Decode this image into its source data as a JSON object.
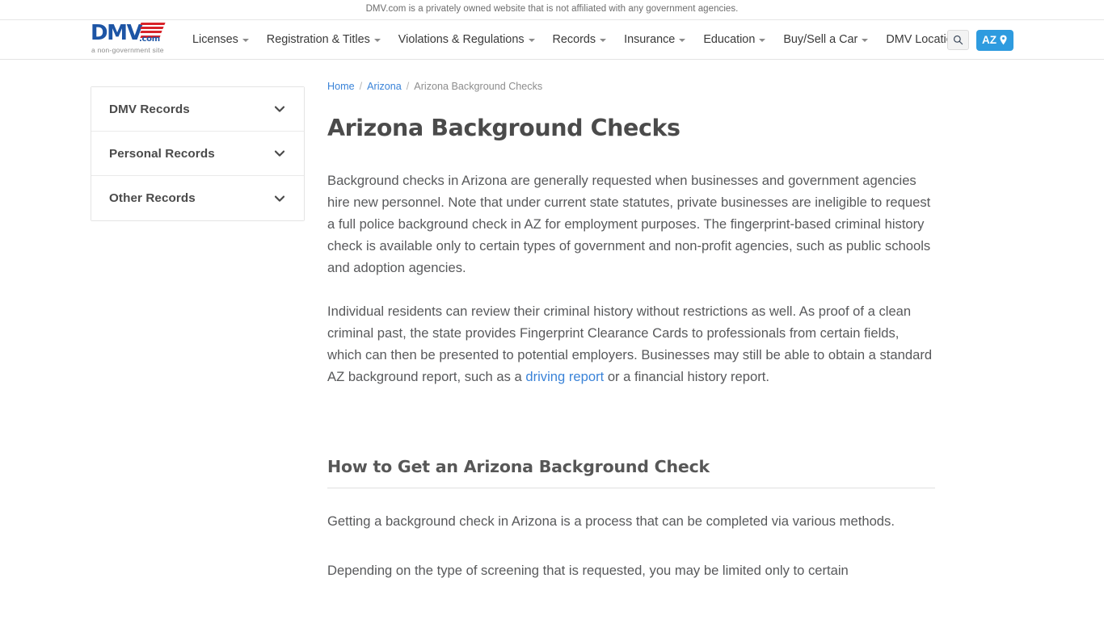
{
  "disclaimer": {
    "text": "DMV.com is a privately owned website that is not affiliated with any government agencies."
  },
  "header": {
    "logo": {
      "wordmark": "DMV",
      "dotcom": ".com",
      "tagline": "a non-government site",
      "brand_blue": "#1d55a5",
      "brand_red": "#d8232a"
    },
    "nav": [
      {
        "label": "Licenses",
        "has_dropdown": true
      },
      {
        "label": "Registration & Titles",
        "has_dropdown": true
      },
      {
        "label": "Violations & Regulations",
        "has_dropdown": true
      },
      {
        "label": "Records",
        "has_dropdown": true
      },
      {
        "label": "Insurance",
        "has_dropdown": true
      },
      {
        "label": "Education",
        "has_dropdown": true
      },
      {
        "label": "Buy/Sell a Car",
        "has_dropdown": true
      },
      {
        "label": "DMV Locations",
        "has_dropdown": false
      }
    ],
    "search_icon": "search-icon",
    "state_button": {
      "label": "AZ",
      "icon": "map-pin-icon",
      "color": "#2e9bdf"
    }
  },
  "sidebar": {
    "items": [
      {
        "label": "DMV Records",
        "icon": "chevron-down-icon"
      },
      {
        "label": "Personal Records",
        "icon": "chevron-down-icon"
      },
      {
        "label": "Other Records",
        "icon": "chevron-down-icon"
      }
    ]
  },
  "breadcrumb": {
    "home": "Home",
    "state": "Arizona",
    "current": "Arizona Background Checks",
    "separator": "/"
  },
  "main": {
    "title": "Arizona Background Checks",
    "paragraph_1": "Background checks in Arizona are generally requested when businesses and government agencies hire new personnel. Note that under current state statutes, private businesses are ineligible to request a full police background check in AZ for employment purposes. The fingerprint-based criminal history check is available only to certain types of government and non-profit agencies, such as public schools and adoption agencies.",
    "paragraph_2_part_1": "Individual residents can review their criminal history without restrictions as well. As proof of a clean criminal past, the state provides Fingerprint Clearance Cards to professionals from certain fields, which can then be presented to potential employers. Businesses may still be able to obtain a standard AZ background report, such as a ",
    "paragraph_2_link": "driving report",
    "paragraph_2_part_2": " or a financial history report.",
    "section_title": "How to Get an Arizona Background Check",
    "paragraph_3": "Getting a background check in Arizona is a process that can be completed via various methods.",
    "paragraph_4": "Depending on the type of screening that is requested, you may be limited only to certain"
  },
  "colors": {
    "link": "#3a83d8",
    "body_text": "#58595b",
    "heading": "#4b4b4b",
    "accent": "#2e9bdf"
  }
}
